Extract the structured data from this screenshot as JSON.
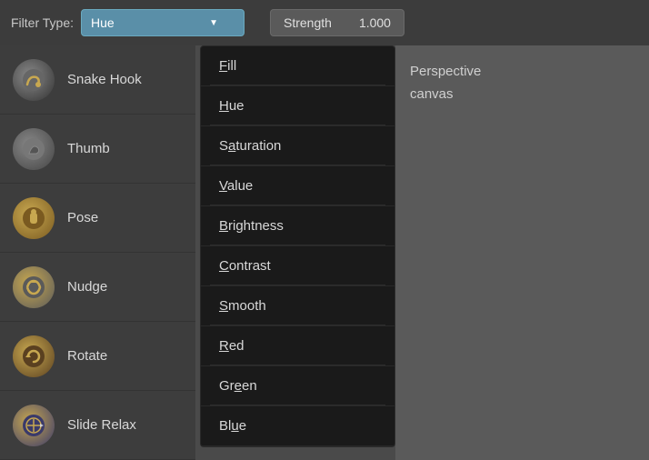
{
  "topbar": {
    "filter_label": "Filter Type:",
    "filter_value": "Hue",
    "strength_label": "Strength",
    "strength_value": "1.000"
  },
  "dropdown": {
    "items": [
      {
        "id": "fill",
        "label": "Fill",
        "underline_index": 0
      },
      {
        "id": "hue",
        "label": "Hue",
        "underline_index": 0,
        "active": true
      },
      {
        "id": "saturation",
        "label": "Saturation",
        "underline_index": 1
      },
      {
        "id": "value",
        "label": "Value",
        "underline_index": 1
      },
      {
        "id": "brightness",
        "label": "Brightness",
        "underline_index": 1
      },
      {
        "id": "contrast",
        "label": "Contrast",
        "underline_index": 1
      },
      {
        "id": "smooth",
        "label": "Smooth",
        "underline_index": 1
      },
      {
        "id": "red",
        "label": "Red",
        "underline_index": 1
      },
      {
        "id": "green",
        "label": "Green",
        "underline_index": 2
      },
      {
        "id": "blue",
        "label": "Blue",
        "underline_index": 1
      }
    ]
  },
  "sidebar": {
    "items": [
      {
        "id": "snake-hook",
        "label": "Snake Hook",
        "icon_class": "icon-snake"
      },
      {
        "id": "thumb",
        "label": "Thumb",
        "icon_class": "icon-thumb"
      },
      {
        "id": "pose",
        "label": "Pose",
        "icon_class": "icon-pose"
      },
      {
        "id": "nudge",
        "label": "Nudge",
        "icon_class": "icon-nudge"
      },
      {
        "id": "rotate",
        "label": "Rotate",
        "icon_class": "icon-rotate"
      },
      {
        "id": "slide-relax",
        "label": "Slide Relax",
        "icon_class": "icon-slide"
      }
    ]
  },
  "viewport": {
    "perspective_label": "Perspective",
    "canvas_label": "canvas"
  }
}
